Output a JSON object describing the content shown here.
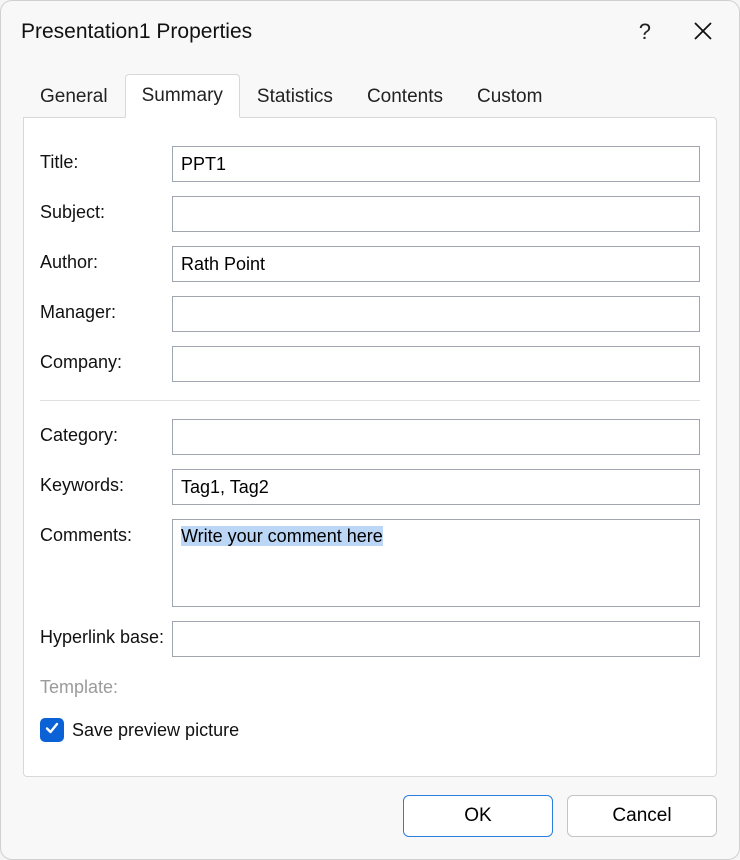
{
  "titlebar": {
    "title": "Presentation1 Properties",
    "help_label": "?"
  },
  "tabs": [
    {
      "label": "General",
      "active": false
    },
    {
      "label": "Summary",
      "active": true
    },
    {
      "label": "Statistics",
      "active": false
    },
    {
      "label": "Contents",
      "active": false
    },
    {
      "label": "Custom",
      "active": false
    }
  ],
  "form": {
    "title": {
      "label": "Title:",
      "value": "PPT1"
    },
    "subject": {
      "label": "Subject:",
      "value": ""
    },
    "author": {
      "label": "Author:",
      "value": "Rath Point"
    },
    "manager": {
      "label": "Manager:",
      "value": ""
    },
    "company": {
      "label": "Company:",
      "value": ""
    },
    "category": {
      "label": "Category:",
      "value": ""
    },
    "keywords": {
      "label": "Keywords:",
      "value": "Tag1, Tag2"
    },
    "comments": {
      "label": "Comments:",
      "value": "Write your comment here",
      "selected": true
    },
    "hyperlink_base": {
      "label": "Hyperlink base:",
      "value": ""
    },
    "template": {
      "label": "Template:",
      "value": ""
    },
    "save_preview": {
      "label": "Save preview picture",
      "checked": true
    }
  },
  "buttons": {
    "ok": "OK",
    "cancel": "Cancel"
  }
}
